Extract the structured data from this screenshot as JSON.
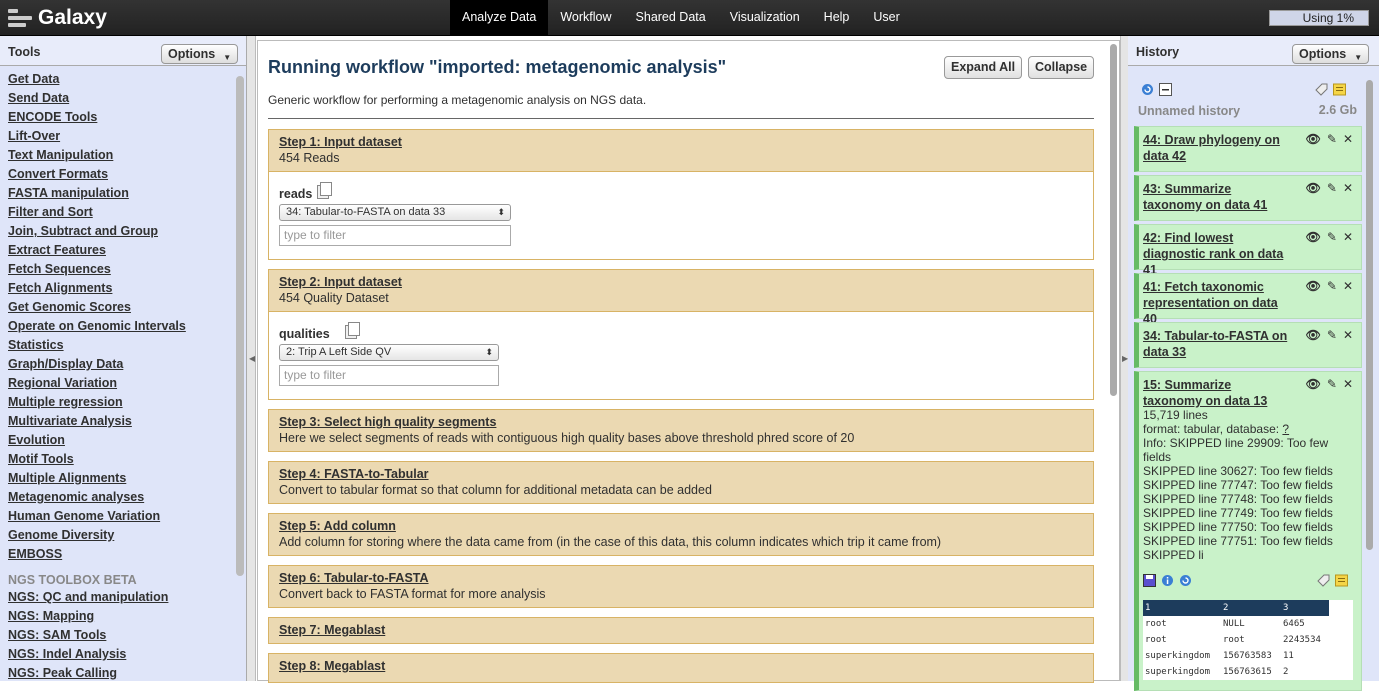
{
  "masthead": {
    "brand": "Galaxy",
    "tabs": [
      "Analyze Data",
      "Workflow",
      "Shared Data",
      "Visualization",
      "Help",
      "User"
    ],
    "active_tab": "Analyze Data",
    "usage": "Using 1%"
  },
  "tools_panel": {
    "title": "Tools",
    "options_label": "Options",
    "tools": [
      "Get Data",
      "Send Data",
      "ENCODE Tools",
      "Lift-Over",
      "Text Manipulation",
      "Convert Formats",
      "FASTA manipulation",
      "Filter and Sort",
      "Join, Subtract and Group",
      "Extract Features",
      "Fetch Sequences",
      "Fetch Alignments",
      "Get Genomic Scores",
      "Operate on Genomic Intervals",
      "Statistics",
      "Graph/Display Data",
      "Regional Variation",
      "Multiple regression",
      "Multivariate Analysis",
      "Evolution",
      "Motif Tools",
      "Multiple Alignments",
      "Metagenomic analyses",
      "Human Genome Variation",
      "Genome Diversity",
      "EMBOSS"
    ],
    "section_label": "NGS TOOLBOX BETA",
    "ngs_tools": [
      "NGS: QC and manipulation",
      "NGS: Mapping",
      "NGS: SAM Tools",
      "NGS: Indel Analysis",
      "NGS: Peak Calling"
    ]
  },
  "workflow": {
    "title": "Running workflow \"imported: metagenomic analysis\"",
    "expand_label": "Expand All",
    "collapse_label": "Collapse",
    "description": "Generic workflow for performing a metagenomic analysis on NGS data.",
    "steps": [
      {
        "title": "Step 1: Input dataset",
        "desc": "454 Reads",
        "param": "reads",
        "selected": "34: Tabular-to-FASTA on data 33",
        "filter_placeholder": "type to filter"
      },
      {
        "title": "Step 2: Input dataset",
        "desc": "454 Quality Dataset",
        "param": "qualities",
        "selected": "2: Trip A Left Side QV",
        "filter_placeholder": "type to filter"
      },
      {
        "title": "Step 3: Select high quality segments",
        "desc": "Here we select segments of reads with contiguous high quality bases above threshold phred score of 20"
      },
      {
        "title": "Step 4: FASTA-to-Tabular",
        "desc": "Convert to tabular format so that column for additional metadata can be added"
      },
      {
        "title": "Step 5: Add column",
        "desc": "Add column for storing where the data came from (in the case of this data, this column indicates which trip it came from)"
      },
      {
        "title": "Step 6: Tabular-to-FASTA",
        "desc": "Convert back to FASTA format for more analysis"
      },
      {
        "title": "Step 7: Megablast",
        "desc": ""
      },
      {
        "title": "Step 8: Megablast",
        "desc": ""
      }
    ]
  },
  "history_panel": {
    "title": "History",
    "options_label": "Options",
    "name": "Unnamed history",
    "size": "2.6 Gb",
    "datasets": [
      {
        "title": "44: Draw phylogeny on data 42"
      },
      {
        "title": "43: Summarize taxonomy on data 41"
      },
      {
        "title": "42: Find lowest diagnostic rank on data 41"
      },
      {
        "title": "41: Fetch taxonomic representation on data 40"
      },
      {
        "title": "34: Tabular-to-FASTA on data 33"
      },
      {
        "title": "15: Summarize taxonomy on data 13"
      }
    ],
    "expanded": {
      "lines": "15,719 lines",
      "format": "format: tabular, database: ",
      "database": "?",
      "info": [
        "Info: SKIPPED line 29909: Too few fields",
        "SKIPPED line 30627: Too few fields",
        "SKIPPED line 77747: Too few fields",
        "SKIPPED line 77748: Too few fields",
        "SKIPPED line 77749: Too few fields",
        "SKIPPED line 77750: Too few fields",
        "SKIPPED line 77751: Too few fields",
        "SKIPPED li"
      ],
      "peek_header": [
        "1",
        "2",
        "3"
      ],
      "peek_rows": [
        [
          "root",
          "NULL",
          "6465"
        ],
        [
          "root",
          "root",
          "2243534"
        ],
        [
          "superkingdom",
          "156763583",
          "11"
        ],
        [
          "superkingdom",
          "156763615",
          "2"
        ]
      ]
    }
  }
}
